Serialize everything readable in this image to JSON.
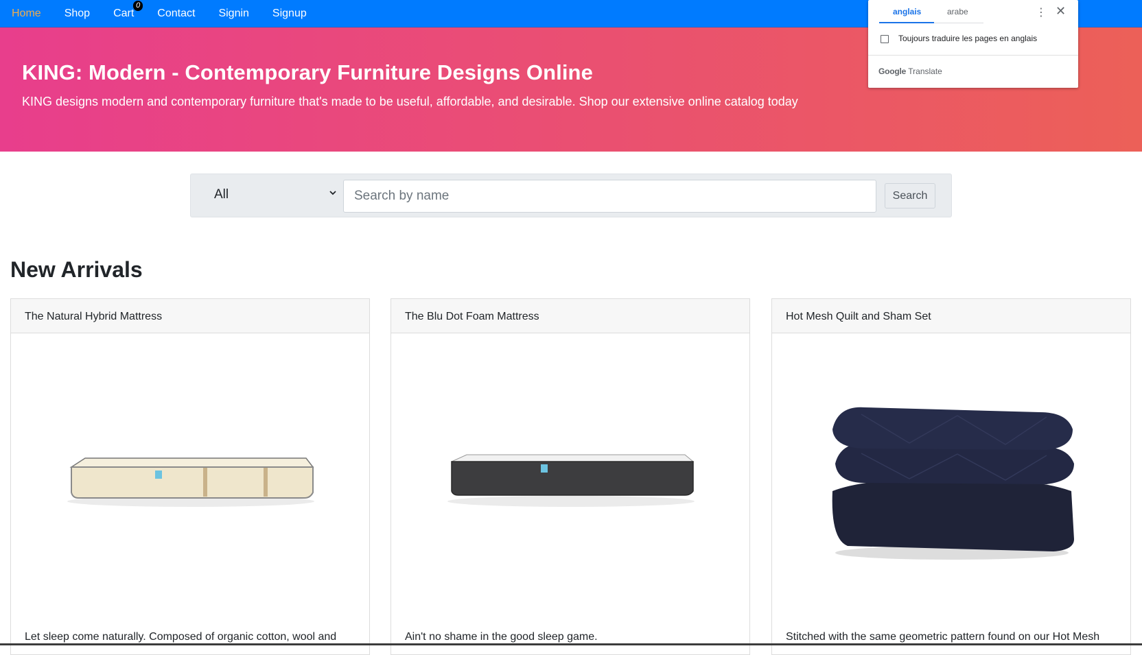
{
  "nav": {
    "items": [
      {
        "label": "Home"
      },
      {
        "label": "Shop"
      },
      {
        "label": "Cart"
      },
      {
        "label": "Contact"
      },
      {
        "label": "Signin"
      },
      {
        "label": "Signup"
      }
    ],
    "cart_count": "0"
  },
  "jumbotron": {
    "title": "KING: Modern - Contemporary Furniture Designs Online",
    "subtitle": "KING designs modern and contemporary furniture that's made to be useful, affordable, and desirable. Shop our extensive online catalog today"
  },
  "search": {
    "category_selected": "All",
    "placeholder": "Search by name",
    "button_label": "Search"
  },
  "section_title": "New Arrivals",
  "products": [
    {
      "name": "The Natural Hybrid Mattress",
      "description": "Let sleep come naturally. Composed of organic cotton, wool and"
    },
    {
      "name": "The Blu Dot Foam Mattress",
      "description": "Ain't no shame in the good sleep game."
    },
    {
      "name": "Hot Mesh Quilt and Sham Set",
      "description": "Stitched with the same geometric pattern found on our Hot Mesh"
    }
  ],
  "translate_popup": {
    "tab_active": "anglais",
    "tab_other": "arabe",
    "checkbox_label": "Toujours traduire les pages en anglais",
    "brand_google": "Google",
    "brand_translate": "Translate"
  },
  "colors": {
    "navbar": "#007bff",
    "nav_active": "#f0ad4e",
    "jumbo_gradient_start": "#e83e8c",
    "jumbo_gradient_end": "#ec6058"
  }
}
